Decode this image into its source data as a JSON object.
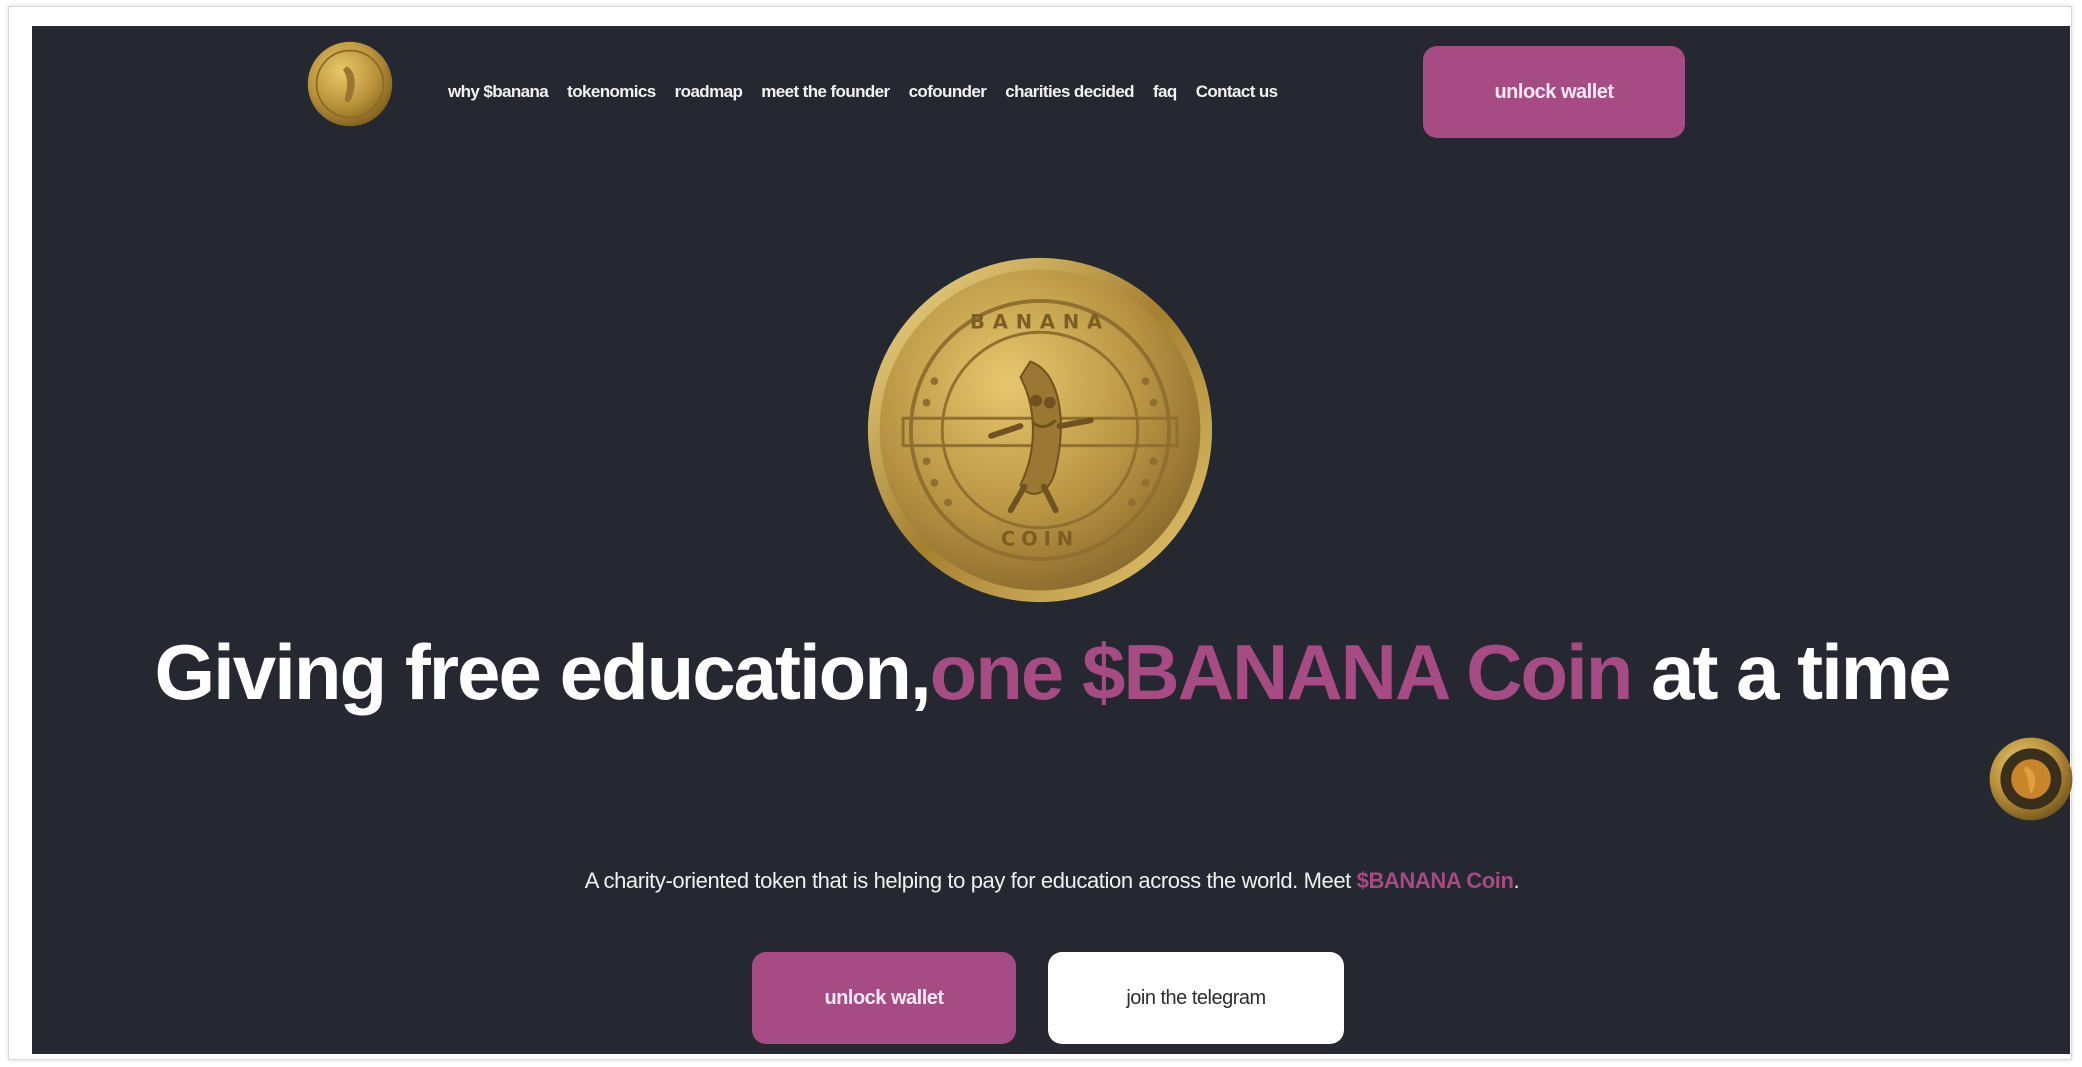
{
  "header": {
    "logo_icon": "banana-coin-logo",
    "nav": [
      {
        "label": "why $banana"
      },
      {
        "label": "tokenomics"
      },
      {
        "label": "roadmap"
      },
      {
        "label": "meet the founder"
      },
      {
        "label": "cofounder"
      },
      {
        "label": "charities decided"
      },
      {
        "label": "faq"
      },
      {
        "label": "Contact us"
      }
    ],
    "unlock_wallet_label": "unlock wallet"
  },
  "hero": {
    "coin_image": "banana-coin-image",
    "coin_top_text": "BANANA",
    "coin_bottom_text": "COIN",
    "headline_part1": "Giving free education,",
    "headline_accent": "one $BANANA Coin",
    "headline_part2": "at a time",
    "subtext_main": "A charity-oriented token that is helping to pay for education across the world. Meet ",
    "subtext_accent": "$BANANA Coin",
    "subtext_end": ".",
    "unlock_wallet_label": "unlock wallet",
    "telegram_label": "join the telegram"
  },
  "colors": {
    "background": "#252830",
    "accent": "#a64b84",
    "text": "#ffffff",
    "gold": "#c9a548"
  }
}
